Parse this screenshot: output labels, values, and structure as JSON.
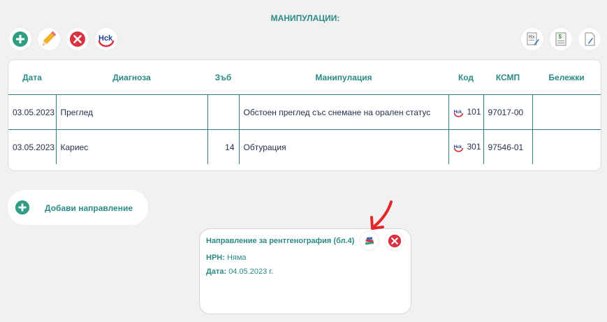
{
  "page_title": "МАНИПУЛАЦИИ:",
  "toolbar": {
    "left_icons": [
      "add-icon",
      "edit-icon",
      "delete-icon",
      "nzok-icon"
    ],
    "right_icons": [
      "prescription-icon",
      "invoice-icon",
      "document-icon"
    ]
  },
  "table": {
    "headers": [
      "Дата",
      "Диагноза",
      "Зъб",
      "Манипулация",
      "Код",
      "КСМП",
      "Бележки"
    ],
    "rows": [
      {
        "date": "03.05.2023",
        "diagnosis": "Преглед",
        "tooth": "",
        "procedure": "Обстоен преглед със снемане на орален статус",
        "code": "101",
        "ksmp": "97017-00",
        "notes": ""
      },
      {
        "date": "03.05.2023",
        "diagnosis": "Кариес",
        "tooth": "14",
        "procedure": "Обтурация",
        "code": "301",
        "ksmp": "97546-01",
        "notes": ""
      }
    ]
  },
  "add_referral": {
    "label": "Добави направление"
  },
  "referral": {
    "title": "Направление за рентгенография (бл.4)",
    "nrn_label": "НРН:",
    "nrn_value": "Няма",
    "date_label": "Дата:",
    "date_value": "04.05.2023 г."
  },
  "colors": {
    "accent": "#2b8a86",
    "add": "#2f9e85",
    "delete": "#d93343",
    "annotation": "#e5252a"
  }
}
